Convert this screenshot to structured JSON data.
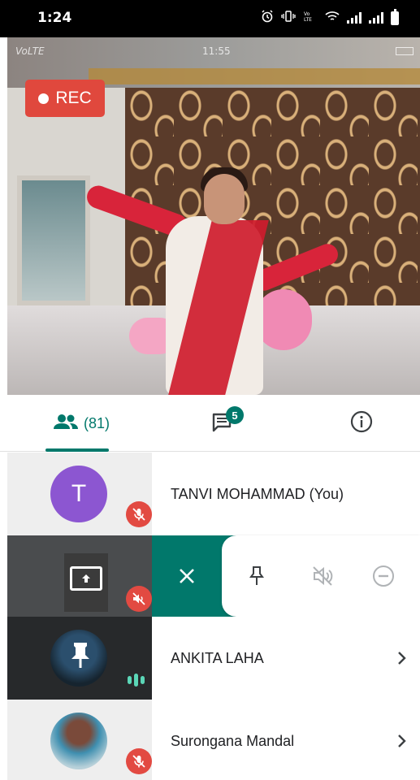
{
  "status_bar": {
    "time": "1:24",
    "icons": [
      "alarm-icon",
      "vibrate-icon",
      "volte-icon",
      "wifi-icon",
      "signal-icon",
      "signal-icon",
      "battery-icon"
    ]
  },
  "video": {
    "overlay_carrier": "VoLTE",
    "overlay_time": "11:55",
    "rec_label": "REC"
  },
  "tabs": {
    "people_count": "(81)",
    "chat_badge": "5",
    "active": "people"
  },
  "participants": [
    {
      "name": "TANVI MOHAMMAD (You)",
      "avatar_letter": "T",
      "avatar_color": "#8c56d1",
      "muted": true
    },
    {
      "name": "",
      "presenting": true,
      "muted": true,
      "actions": [
        "close-icon",
        "pin-icon",
        "mute-icon",
        "remove-icon"
      ]
    },
    {
      "name": "ANKITA LAHA",
      "speaking": true
    },
    {
      "name": "Surongana Mandal",
      "muted": true
    }
  ],
  "colors": {
    "accent": "#01786b",
    "mute_red": "#e24a42",
    "rec_red": "#e0483d"
  }
}
